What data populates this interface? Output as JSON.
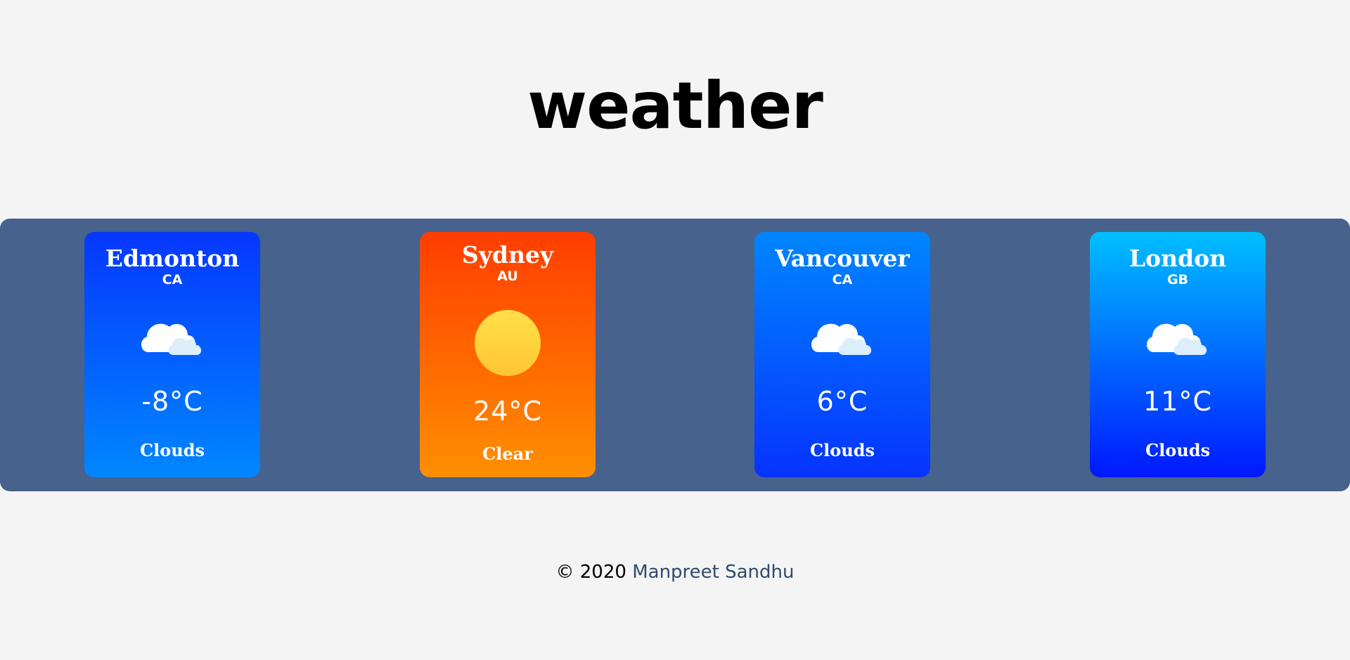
{
  "header": {
    "title": "weather"
  },
  "cards": [
    {
      "city": "Edmonton",
      "country": "CA",
      "temperature": "-8°C",
      "condition": "Clouds",
      "icon": "cloud-icon"
    },
    {
      "city": "Sydney",
      "country": "AU",
      "temperature": "24°C",
      "condition": "Clear",
      "icon": "sun-icon"
    },
    {
      "city": "Vancouver",
      "country": "CA",
      "temperature": "6°C",
      "condition": "Clouds",
      "icon": "cloud-icon"
    },
    {
      "city": "London",
      "country": "GB",
      "temperature": "11°C",
      "condition": "Clouds",
      "icon": "cloud-icon"
    }
  ],
  "footer": {
    "copyright": "© 2020",
    "author": "Manpreet Sandhu"
  },
  "colors": {
    "background": "#f4f4f4",
    "band": "#47628c",
    "author_link": "#304a6e"
  }
}
